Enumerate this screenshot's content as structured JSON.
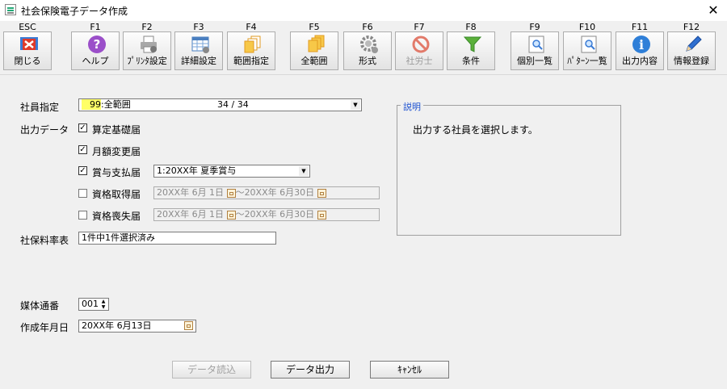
{
  "window": {
    "title": "社会保険電子データ作成",
    "close": "✕"
  },
  "toolbar": [
    {
      "key": "ESC",
      "label": "閉じる",
      "icon": "close-icon"
    },
    {
      "key": "F1",
      "label": "ヘルプ",
      "icon": "help-icon"
    },
    {
      "key": "F2",
      "label": "ﾌﾟﾘﾝﾀ設定",
      "icon": "printer-icon"
    },
    {
      "key": "F3",
      "label": "詳細設定",
      "icon": "detail-settings-icon"
    },
    {
      "key": "F4",
      "label": "範囲指定",
      "icon": "range-icon"
    },
    {
      "key": "F5",
      "label": "全範囲",
      "icon": "all-range-icon"
    },
    {
      "key": "F6",
      "label": "形式",
      "icon": "gear-icon"
    },
    {
      "key": "F7",
      "label": "社労士",
      "icon": "prohibit-icon",
      "disabled": true
    },
    {
      "key": "F8",
      "label": "条件",
      "icon": "filter-icon"
    },
    {
      "key": "F9",
      "label": "個別一覧",
      "icon": "search-list-icon"
    },
    {
      "key": "F10",
      "label": "ﾊﾟﾀｰﾝ一覧",
      "icon": "pattern-list-icon"
    },
    {
      "key": "F11",
      "label": "出力内容",
      "icon": "info-icon"
    },
    {
      "key": "F12",
      "label": "情報登録",
      "icon": "pencil-icon"
    }
  ],
  "form": {
    "employee_label": "社員指定",
    "employee_code": "99",
    "employee_value": ":全範囲",
    "employee_count": "34 / 34",
    "output_label": "出力データ",
    "items": {
      "santei": {
        "label": "算定基礎届",
        "checked": true
      },
      "getsugaku": {
        "label": "月額変更届",
        "checked": true
      },
      "shoyo": {
        "label": "賞与支払届",
        "checked": true,
        "value": "1:20XX年 夏季賞与"
      },
      "shutoku": {
        "label": "資格取得届",
        "checked": false,
        "from": "20XX年  6月  1日",
        "to": "20XX年  6月30日"
      },
      "soshitsu": {
        "label": "資格喪失届",
        "checked": false,
        "from": "20XX年  6月  1日",
        "to": "20XX年  6月30日"
      }
    },
    "range_sep": "～",
    "rate_label": "社保料率表",
    "rate_value": "1件中1件選択済み",
    "media_label": "媒体通番",
    "media_value": "001",
    "date_label": "作成年月日",
    "date_value": "20XX年  6月13日"
  },
  "description": {
    "title": "説明",
    "text": "出力する社員を選択します。"
  },
  "buttons": {
    "read": "データ読込",
    "output": "データ出力",
    "cancel": "ｷｬﾝｾﾙ"
  },
  "colors": {
    "code_highlight": "#ffff66",
    "group_title": "#1a4fd0"
  }
}
